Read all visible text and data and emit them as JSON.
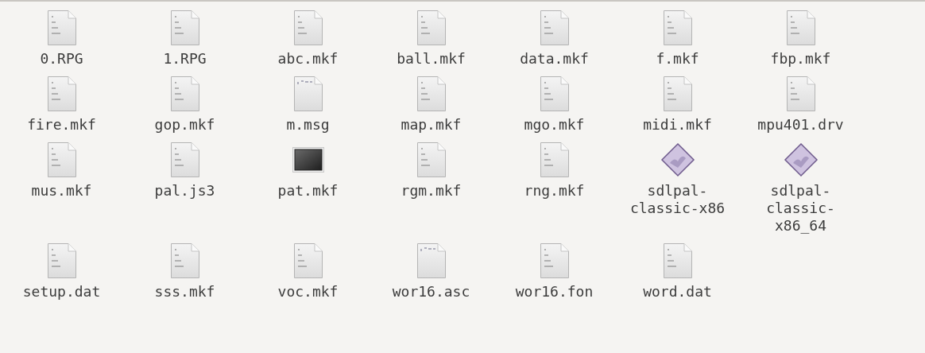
{
  "files": [
    {
      "name": "0.RPG",
      "kind": "binary"
    },
    {
      "name": "1.RPG",
      "kind": "binary"
    },
    {
      "name": "abc.mkf",
      "kind": "binary"
    },
    {
      "name": "ball.mkf",
      "kind": "binary"
    },
    {
      "name": "data.mkf",
      "kind": "binary"
    },
    {
      "name": "f.mkf",
      "kind": "binary"
    },
    {
      "name": "fbp.mkf",
      "kind": "binary"
    },
    {
      "name": "fire.mkf",
      "kind": "binary"
    },
    {
      "name": "gop.mkf",
      "kind": "binary"
    },
    {
      "name": "m.msg",
      "kind": "text"
    },
    {
      "name": "map.mkf",
      "kind": "binary"
    },
    {
      "name": "mgo.mkf",
      "kind": "binary"
    },
    {
      "name": "midi.mkf",
      "kind": "binary"
    },
    {
      "name": "mpu401.drv",
      "kind": "binary"
    },
    {
      "name": "mus.mkf",
      "kind": "binary"
    },
    {
      "name": "pal.js3",
      "kind": "binary"
    },
    {
      "name": "pat.mkf",
      "kind": "image"
    },
    {
      "name": "rgm.mkf",
      "kind": "binary"
    },
    {
      "name": "rng.mkf",
      "kind": "binary"
    },
    {
      "name": "sdlpal-classic-x86",
      "kind": "executable"
    },
    {
      "name": "sdlpal-classic-x86_64",
      "kind": "executable"
    },
    {
      "name": "setup.dat",
      "kind": "binary"
    },
    {
      "name": "sss.mkf",
      "kind": "binary"
    },
    {
      "name": "voc.mkf",
      "kind": "binary"
    },
    {
      "name": "wor16.asc",
      "kind": "text"
    },
    {
      "name": "wor16.fon",
      "kind": "binary"
    },
    {
      "name": "word.dat",
      "kind": "binary"
    }
  ]
}
